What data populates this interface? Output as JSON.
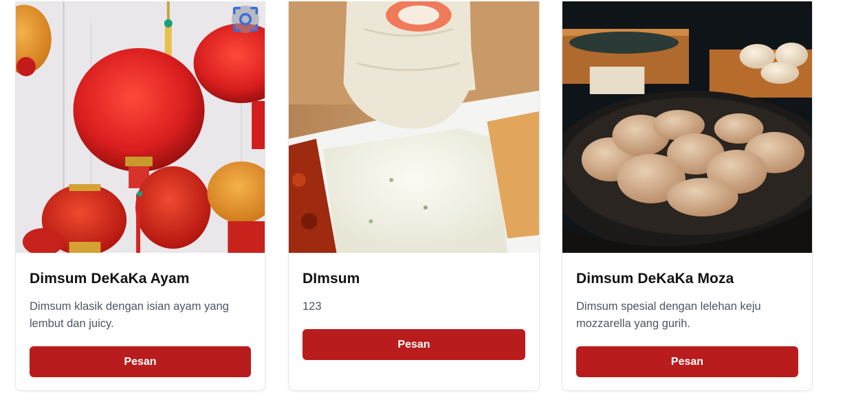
{
  "products": [
    {
      "title": "Dimsum DeKaKa Ayam",
      "description": "Dimsum klasik dengan isian ayam yang lembut dan juicy.",
      "button_label": "Pesan",
      "image_subject": "red-lanterns-photo"
    },
    {
      "title": "DImsum",
      "description": "123",
      "button_label": "Pesan",
      "image_subject": "dimsum-with-sauce-photo"
    },
    {
      "title": "Dimsum DeKaKa Moza",
      "description": "Dimsum spesial dengan lelehan keju mozzarella yang gurih.",
      "button_label": "Pesan",
      "image_subject": "steamed-dumplings-photo"
    }
  ],
  "overlay_icon": "visual-search-icon",
  "colors": {
    "button": "#b91c1c",
    "title": "#111111",
    "description": "#4b5563",
    "card_border": "#e5e7eb"
  }
}
